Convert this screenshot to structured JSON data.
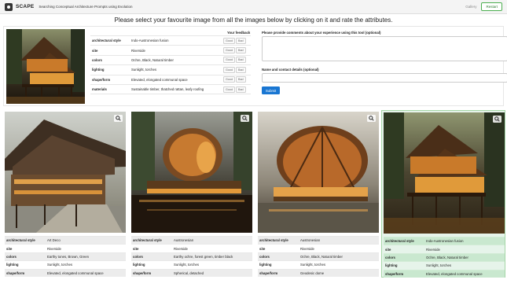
{
  "navbar": {
    "brand": "SCAPE",
    "tagline": "Searching Conceptual Architecture Prompts using Evolution",
    "gallery_label": "Gallery",
    "restart_label": "Restart"
  },
  "headline": "Please select your favourite image from all the images below by clicking on it and rate the attributes.",
  "feedback": {
    "header": "Your feedback",
    "good_label": "Good",
    "bad_label": "Bad",
    "rows": [
      {
        "key": "architectural style",
        "value": "Indo-Austronesian fusion"
      },
      {
        "key": "site",
        "value": "Riverside"
      },
      {
        "key": "colors",
        "value": "Ochre, Black, Natural timber"
      },
      {
        "key": "lighting",
        "value": "Sunlight, torches"
      },
      {
        "key": "shape/form",
        "value": "Elevated, elongated communal space"
      },
      {
        "key": "materials",
        "value": "Sustainable timber, thatched rattan, leafy roofing"
      }
    ]
  },
  "comments": {
    "label": "Please provide comments about your experience using this tool (optional)",
    "value": "",
    "contact_label": "Name and contact details (optional)",
    "contact_value": "",
    "submit_label": "Submit"
  },
  "cards": [
    {
      "selected": false,
      "rows": [
        {
          "key": "architectural style",
          "value": "Art Deco"
        },
        {
          "key": "site",
          "value": "Riverside"
        },
        {
          "key": "colors",
          "value": "Earthy tones, Brown, Green"
        },
        {
          "key": "lighting",
          "value": "Sunlight, torches"
        },
        {
          "key": "shape/form",
          "value": "Elevated, elongated communal space"
        }
      ]
    },
    {
      "selected": false,
      "rows": [
        {
          "key": "architectural style",
          "value": "Austronesian"
        },
        {
          "key": "site",
          "value": "Riverside"
        },
        {
          "key": "colors",
          "value": "Earthy ochre, forest green, timber black"
        },
        {
          "key": "lighting",
          "value": "Sunlight, torches"
        },
        {
          "key": "shape/form",
          "value": "Spherical, detached"
        }
      ]
    },
    {
      "selected": false,
      "rows": [
        {
          "key": "architectural style",
          "value": "Austronesian"
        },
        {
          "key": "site",
          "value": "Riverside"
        },
        {
          "key": "colors",
          "value": "Ochre, Black, Natural timber"
        },
        {
          "key": "lighting",
          "value": "Sunlight, torches"
        },
        {
          "key": "shape/form",
          "value": "Geodesic dome"
        }
      ]
    },
    {
      "selected": true,
      "rows": [
        {
          "key": "architectural style",
          "value": "Indo-Austronesian fusion"
        },
        {
          "key": "site",
          "value": "Riverside"
        },
        {
          "key": "colors",
          "value": "Ochre, Black, Natural timber"
        },
        {
          "key": "lighting",
          "value": "Sunlight, torches"
        },
        {
          "key": "shape/form",
          "value": "Elevated, elongated communal space"
        }
      ]
    }
  ],
  "icons": {
    "logo": "scape-logo-icon",
    "zoom": "magnifier-icon"
  },
  "colors": {
    "accent": "#1976d2",
    "selected_bg": "#e6f4ea",
    "restart": "#2e7d32"
  }
}
